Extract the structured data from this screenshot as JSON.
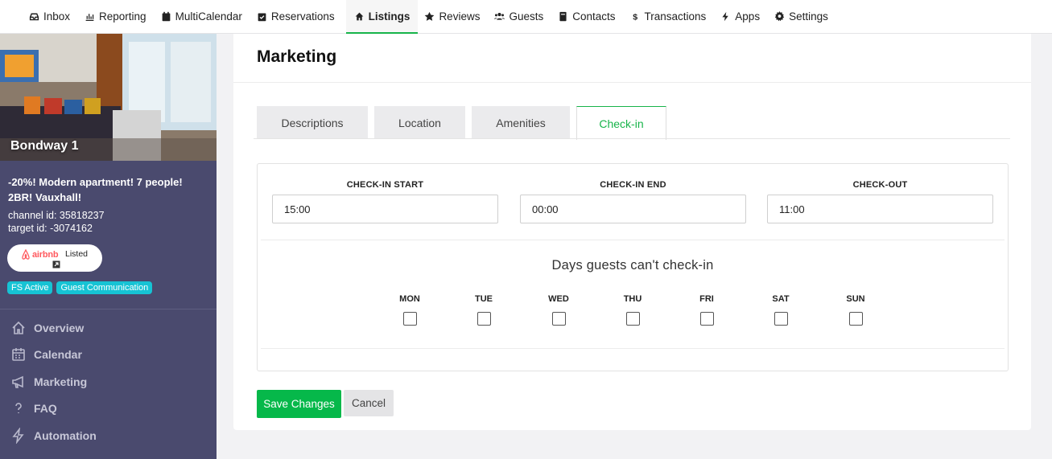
{
  "topnav": {
    "items": [
      {
        "label": "Inbox",
        "icon": "inbox-icon"
      },
      {
        "label": "Reporting",
        "icon": "bar-chart-icon"
      },
      {
        "label": "MultiCalendar",
        "icon": "calendar-icon"
      },
      {
        "label": "Reservations",
        "icon": "calendar-check-icon"
      },
      {
        "label": "Listings",
        "icon": "home-icon",
        "active": true
      },
      {
        "label": "Reviews",
        "icon": "star-icon"
      },
      {
        "label": "Guests",
        "icon": "users-icon"
      },
      {
        "label": "Contacts",
        "icon": "address-book-icon"
      },
      {
        "label": "Transactions",
        "icon": "dollar-icon"
      },
      {
        "label": "Apps",
        "icon": "bolt-icon"
      },
      {
        "label": "Settings",
        "icon": "gear-icon"
      }
    ]
  },
  "sidebar": {
    "listing_name": "Bondway 1",
    "description": "-20%! Modern apartment! 7 people! 2BR! Vauxhall!",
    "channel_id": "channel id: 35818237",
    "target_id": "target id: -3074162",
    "airbnb": {
      "brand": "airbnb",
      "status": "Listed",
      "brand_color": "#ff5a5f"
    },
    "badges": [
      "FS Active",
      "Guest Communication"
    ],
    "menu": [
      {
        "label": "Overview",
        "icon": "home-outline-icon"
      },
      {
        "label": "Calendar",
        "icon": "calendar-outline-icon"
      },
      {
        "label": "Marketing",
        "icon": "megaphone-icon"
      },
      {
        "label": "FAQ",
        "icon": "question-icon"
      },
      {
        "label": "Automation",
        "icon": "bolt-outline-icon"
      }
    ]
  },
  "main": {
    "title": "Marketing",
    "tabs": [
      {
        "label": "Descriptions"
      },
      {
        "label": "Location"
      },
      {
        "label": "Amenities"
      },
      {
        "label": "Check-in",
        "active": true
      }
    ],
    "checkin": {
      "start_label": "CHECK-IN START",
      "start_value": "15:00",
      "end_label": "CHECK-IN END",
      "end_value": "00:00",
      "checkout_label": "CHECK-OUT",
      "checkout_value": "11:00"
    },
    "days_title": "Days guests can't check-in",
    "days": [
      {
        "label": "MON",
        "checked": false
      },
      {
        "label": "TUE",
        "checked": false
      },
      {
        "label": "WED",
        "checked": false
      },
      {
        "label": "THU",
        "checked": false
      },
      {
        "label": "FRI",
        "checked": false
      },
      {
        "label": "SAT",
        "checked": false
      },
      {
        "label": "SUN",
        "checked": false
      }
    ],
    "save_label": "Save Changes",
    "cancel_label": "Cancel"
  },
  "colors": {
    "accent": "#17b44a",
    "sidebar": "#4a4a6e",
    "badge": "#16c3d4"
  }
}
